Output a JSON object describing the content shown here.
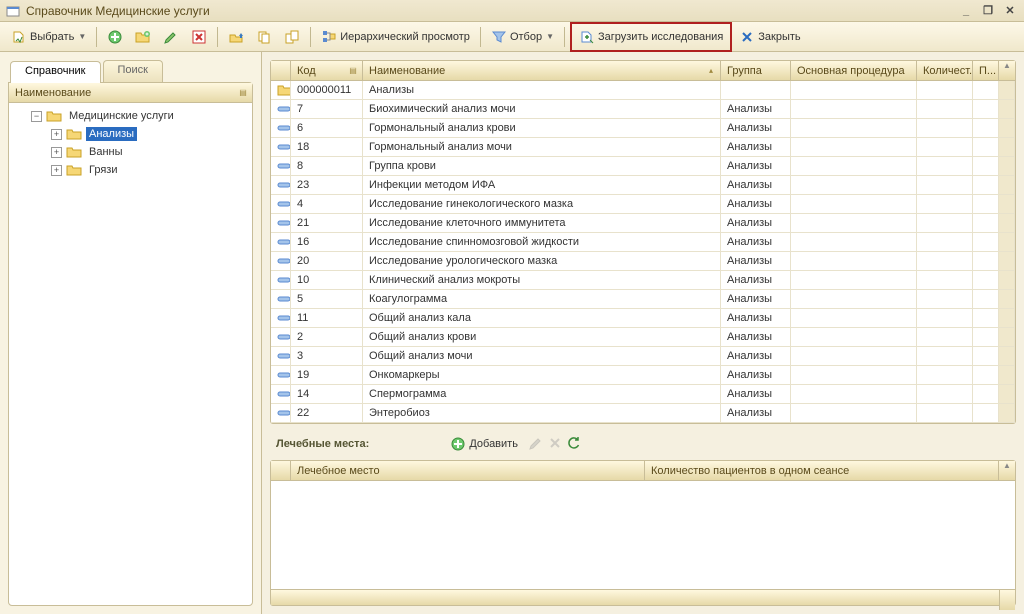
{
  "window": {
    "title": "Справочник Медицинские услуги"
  },
  "toolbar": {
    "select": "Выбрать",
    "hier_view": "Иерархический просмотр",
    "filter": "Отбор",
    "load_research": "Загрузить исследования",
    "close": "Закрыть"
  },
  "tabs": {
    "ref": "Справочник",
    "search": "Поиск"
  },
  "tree": {
    "header": "Наименование",
    "root": "Медицинские услуги",
    "items": [
      "Анализы",
      "Ванны",
      "Грязи"
    ],
    "selected_index": 0
  },
  "grid": {
    "columns": {
      "code": "Код",
      "name": "Наименование",
      "group": "Группа",
      "proc": "Основная процедура",
      "qty": "Количест...",
      "p": "П..."
    },
    "rows": [
      {
        "is_folder": true,
        "code": "000000011",
        "name": "Анализы",
        "group": ""
      },
      {
        "is_folder": false,
        "code": "7",
        "name": "Биохимический анализ мочи",
        "group": "Анализы"
      },
      {
        "is_folder": false,
        "code": "6",
        "name": "Гормональный анализ крови",
        "group": "Анализы"
      },
      {
        "is_folder": false,
        "code": "18",
        "name": "Гормональный анализ мочи",
        "group": "Анализы"
      },
      {
        "is_folder": false,
        "code": "8",
        "name": "Группа крови",
        "group": "Анализы"
      },
      {
        "is_folder": false,
        "code": "23",
        "name": "Инфекции методом ИФА",
        "group": "Анализы"
      },
      {
        "is_folder": false,
        "code": "4",
        "name": "Исследование гинекологического мазка",
        "group": "Анализы"
      },
      {
        "is_folder": false,
        "code": "21",
        "name": "Исследование клеточного иммунитета",
        "group": "Анализы"
      },
      {
        "is_folder": false,
        "code": "16",
        "name": "Исследование спинномозговой жидкости",
        "group": "Анализы"
      },
      {
        "is_folder": false,
        "code": "20",
        "name": "Исследование урологического мазка",
        "group": "Анализы"
      },
      {
        "is_folder": false,
        "code": "10",
        "name": "Клинический анализ мокроты",
        "group": "Анализы"
      },
      {
        "is_folder": false,
        "code": "5",
        "name": "Коагулограмма",
        "group": "Анализы"
      },
      {
        "is_folder": false,
        "code": "11",
        "name": "Общий анализ кала",
        "group": "Анализы"
      },
      {
        "is_folder": false,
        "code": "2",
        "name": "Общий анализ крови",
        "group": "Анализы"
      },
      {
        "is_folder": false,
        "code": "3",
        "name": "Общий анализ мочи",
        "group": "Анализы"
      },
      {
        "is_folder": false,
        "code": "19",
        "name": "Онкомаркеры",
        "group": "Анализы"
      },
      {
        "is_folder": false,
        "code": "14",
        "name": "Спермограмма",
        "group": "Анализы"
      },
      {
        "is_folder": false,
        "code": "22",
        "name": "Энтеробиоз",
        "group": "Анализы"
      }
    ]
  },
  "sub": {
    "title": "Лечебные места:",
    "add": "Добавить",
    "col_place": "Лечебное место",
    "col_count": "Количество пациентов в одном сеансе"
  }
}
